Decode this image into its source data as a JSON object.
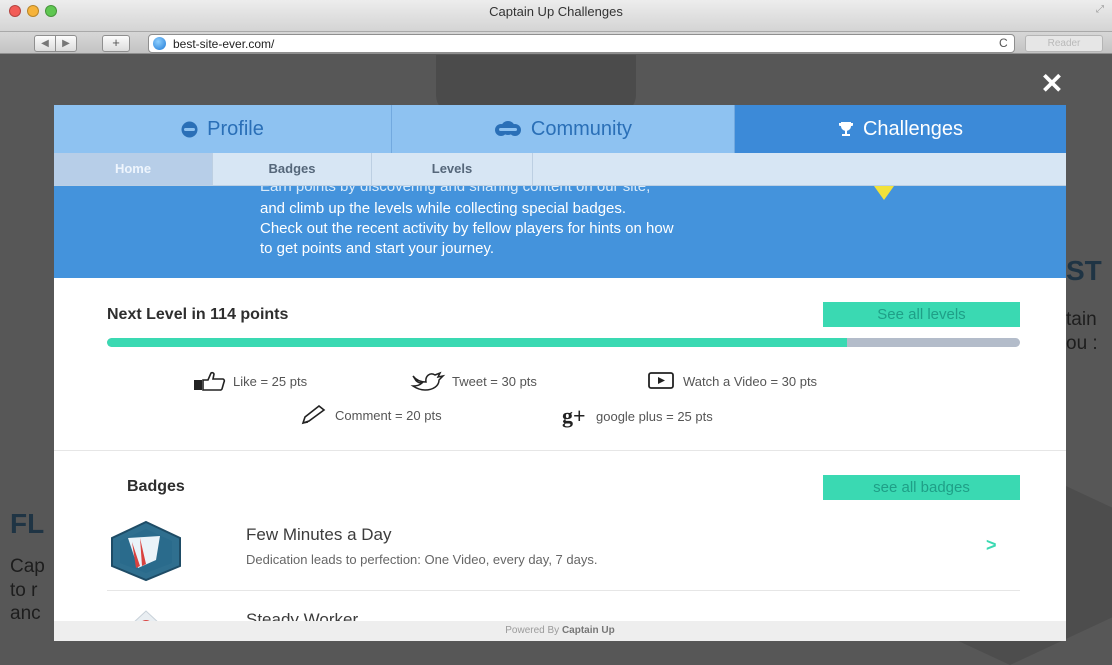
{
  "window": {
    "title": "Captain Up Challenges",
    "url": "best-site-ever.com/",
    "reader_label": "Reader",
    "nav_back": "◀",
    "nav_forward": "▶",
    "add_tab": "+",
    "reload": "C"
  },
  "background_page": {
    "heading_right": "ST",
    "text_right_1": "tain",
    "text_right_2": "ou :",
    "heading_left": "FL",
    "text_left_1": "Cap",
    "text_left_2": "to r",
    "text_left_3": "anc"
  },
  "modal": {
    "close_label": "✕",
    "main_tabs": [
      {
        "label": "Profile",
        "icon": "profile-icon",
        "active": false
      },
      {
        "label": "Community",
        "icon": "community-icon",
        "active": false
      },
      {
        "label": "Challenges",
        "icon": "trophy-icon",
        "active": true
      }
    ],
    "sub_tabs": [
      {
        "label": "Home",
        "active": true
      },
      {
        "label": "Badges",
        "active": false
      },
      {
        "label": "Levels",
        "active": false
      }
    ],
    "intro_lines": [
      "Earn points by discovering and sharing content on our site,",
      "and climb up the levels while collecting special badges.",
      "Check out the recent activity by fellow players for hints on how",
      "to get points and start your journey."
    ],
    "next_level": {
      "title": "Next Level in 114 points",
      "button": "See all levels",
      "progress_fraction": 0.81
    },
    "points": [
      {
        "icon": "thumbs-up-icon",
        "label": "Like = 25 pts"
      },
      {
        "icon": "twitter-bird-icon",
        "label": "Tweet = 30 pts"
      },
      {
        "icon": "play-video-icon",
        "label": "Watch a Video = 30 pts"
      },
      {
        "icon": "pencil-icon",
        "label": "Comment = 20 pts"
      },
      {
        "icon": "google-plus-icon",
        "label": "google plus = 25 pts",
        "icon_text": "g+"
      }
    ],
    "badges": {
      "title": "Badges",
      "button": "see all badges",
      "items": [
        {
          "name": "Few Minutes a Day",
          "description": "Dedication leads to perfection: One Video, every day, 7 days.",
          "chevron": ">"
        },
        {
          "name": "Steady Worker",
          "description": ""
        }
      ]
    },
    "footer": {
      "prefix": "Powered By",
      "brand": "Captain Up"
    }
  },
  "colors": {
    "tab_blue": "#8ec2f1",
    "tab_active": "#3c8ad8",
    "intro_blue": "#4493dc",
    "teal": "#3ad9b2"
  }
}
